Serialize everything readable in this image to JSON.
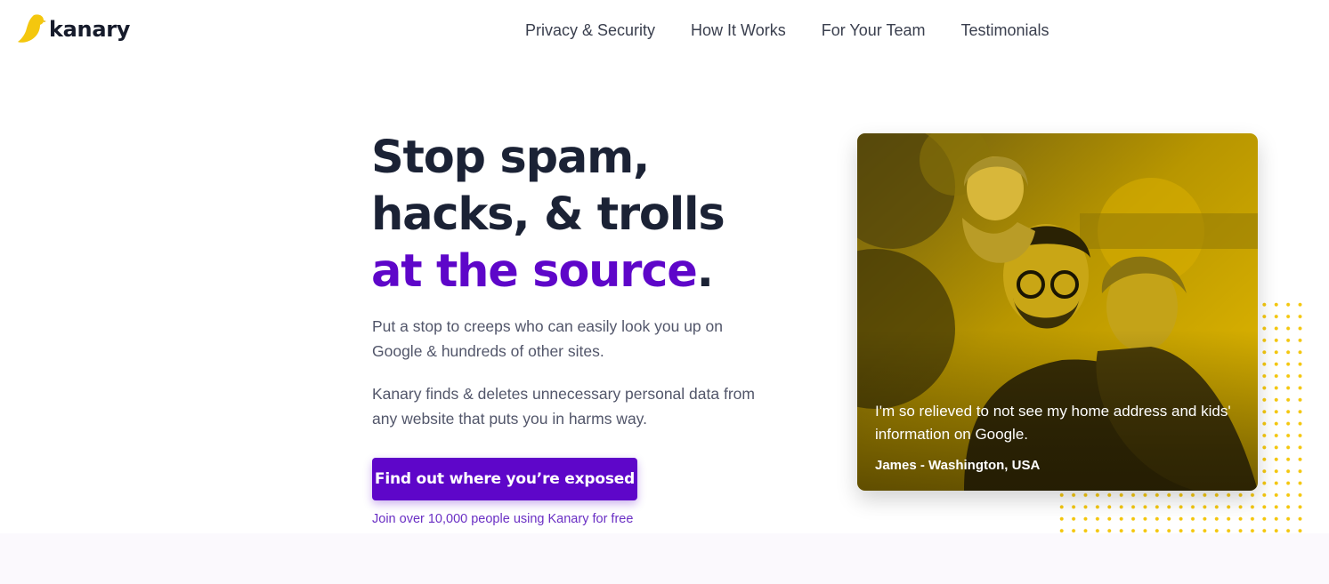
{
  "brand": {
    "name": "kanary",
    "logo_color": "#f4c70e"
  },
  "nav": {
    "items": [
      {
        "label": "Privacy & Security"
      },
      {
        "label": "How It Works"
      },
      {
        "label": "For Your Team"
      },
      {
        "label": "Testimonials"
      }
    ]
  },
  "hero": {
    "title_line1": "Stop spam,",
    "title_line2": "hacks, & trolls",
    "title_accent": "at the source",
    "title_period": ".",
    "paragraph1": "Put a stop to creeps who can easily look you up on Google & hundreds of other sites.",
    "paragraph2": "Kanary finds & deletes unnecessary personal data from any website that puts you in harms way.",
    "cta_label": "Find out where you’re exposed",
    "subnote": "Join over 10,000 people using Kanary for free"
  },
  "testimonial": {
    "quote": "I'm so relieved to not see my home address and kids' information on Google.",
    "author": "James - Washington, USA",
    "photo_icon": "family-photo"
  },
  "colors": {
    "accent": "#5e06c9",
    "heading": "#1b2235",
    "brand_yellow": "#f4c70e"
  }
}
